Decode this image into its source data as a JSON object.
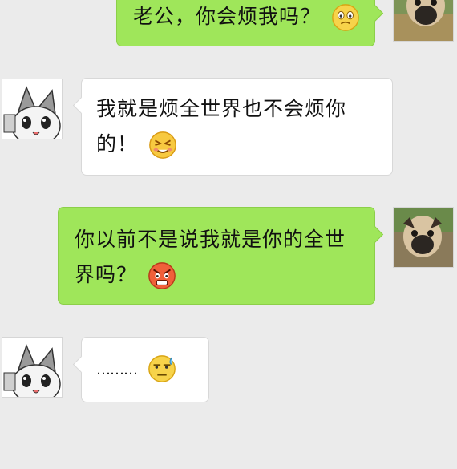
{
  "chat": {
    "messages": [
      {
        "sender": "me",
        "text": "老公，你会烦我吗？",
        "emoji": "smile-sweat-emoji"
      },
      {
        "sender": "other",
        "line1": "我就是烦全世界也不会烦你",
        "line2": "的！",
        "emoji": "wink-emoji"
      },
      {
        "sender": "me",
        "line1": "你以前不是说我就是你的全世",
        "line2": "界吗？",
        "emoji": "angry-emoji"
      },
      {
        "sender": "other",
        "text": "………",
        "emoji": "awkward-sweat-emoji"
      }
    ]
  },
  "colors": {
    "background": "#ebebeb",
    "my_bubble": "#9fe65a",
    "their_bubble": "#ffffff"
  }
}
